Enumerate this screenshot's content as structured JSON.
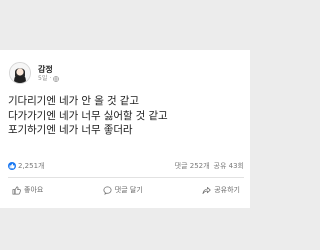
{
  "post": {
    "author": "감정",
    "time": "5일",
    "lines": [
      "기다리기엔 네가 안 올 것 같고",
      "다가가기엔 네가 너무 싫어할 것 같고",
      "포기하기엔 네가 너무 좋더라"
    ]
  },
  "stats": {
    "reactions": "2,251개",
    "comments": "댓글 252개",
    "shares": "공유 43회"
  },
  "actions": {
    "like": "좋아요",
    "comment": "댓글 달기",
    "share": "공유하기"
  },
  "icons": {
    "globe": "globe-icon",
    "like": "thumbs-up-icon",
    "comment": "comment-icon",
    "share": "share-icon"
  },
  "colors": {
    "background": "#ececec",
    "card": "#ffffff",
    "accent": "#1877f2"
  }
}
